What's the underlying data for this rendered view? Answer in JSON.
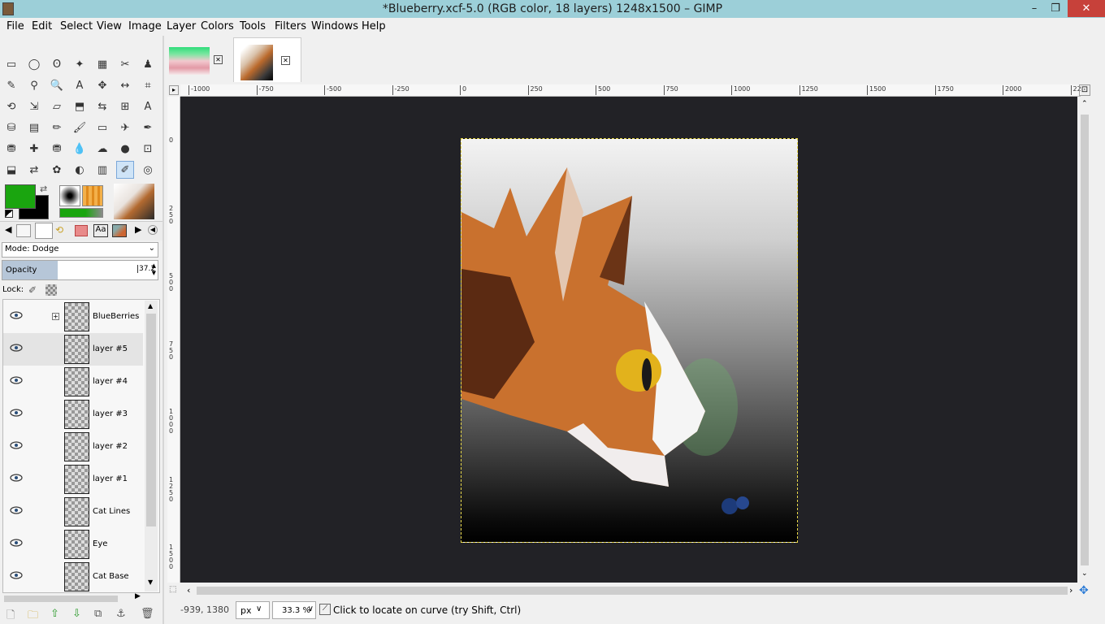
{
  "window": {
    "title": "*Blueberry.xcf-5.0 (RGB color, 18 layers) 1248x1500 – GIMP",
    "minimize": "–",
    "restore": "❐",
    "close": "✕"
  },
  "menu": [
    "File",
    "Edit",
    "Select",
    "View",
    "Image",
    "Layer",
    "Colors",
    "Tools",
    "Filters",
    "Windows",
    "Help"
  ],
  "tools": [
    [
      "rect-select-icon",
      "ellipse-select-icon",
      "free-select-icon",
      "fuzzy-select-icon",
      "color-select-icon",
      "scissors-icon",
      "foreground-select-icon"
    ],
    [
      "paths-icon",
      "color-picker-icon",
      "zoom-icon",
      "measure-icon",
      "move-icon",
      "align-icon",
      "crop-icon"
    ],
    [
      "rotate-icon",
      "scale-icon",
      "shear-icon",
      "perspective-icon",
      "flip-icon",
      "cage-icon",
      "text-icon"
    ],
    [
      "bucket-fill-icon",
      "gradient-icon",
      "pencil-icon",
      "paintbrush-icon",
      "eraser-icon",
      "airbrush-icon",
      "ink-icon"
    ],
    [
      "clone-icon",
      "heal-icon",
      "perspective-clone-icon",
      "blur-icon",
      "smudge-icon",
      "dodge-burn-icon",
      "unified-transform-icon"
    ],
    [
      "warp-icon",
      "handle-transform-icon",
      "mypaint-brush-icon",
      "sharpen-icon",
      "levels-icon",
      "dodge-active-icon",
      "spiral-icon"
    ]
  ],
  "tool_glyphs": [
    [
      "▭",
      "◯",
      "ʘ",
      "✦",
      "▦",
      "✂",
      "♟"
    ],
    [
      "✎",
      "⚲",
      "🔍",
      "A",
      "✥",
      "↔",
      "⌗"
    ],
    [
      "⟲",
      "⇲",
      "▱",
      "⬒",
      "⇆",
      "⊞",
      "A"
    ],
    [
      "⛁",
      "▤",
      "✏",
      "🖌",
      "▭",
      "✈",
      "✒"
    ],
    [
      "⛃",
      "✚",
      "⛃",
      "💧",
      "☁",
      "●",
      "⊡"
    ],
    [
      "⬓",
      "⇄",
      "✿",
      "◐",
      "▥",
      "✐",
      "◎"
    ]
  ],
  "text_tool_label": "A",
  "dock_tabs": [
    "tool-options-tab",
    "layers-tab",
    "paths-tab",
    "undo-tab",
    "brushes-tab",
    "fonts-tab",
    "images-tab"
  ],
  "mode": {
    "label": "Mode: Dodge"
  },
  "opacity": {
    "label": "Opacity",
    "value": "37.2",
    "fraction": 0.372
  },
  "lock": {
    "label": "Lock:"
  },
  "layers": [
    {
      "name": "BlueBerries",
      "group": true,
      "selected": false
    },
    {
      "name": "layer #5",
      "group": false,
      "selected": true
    },
    {
      "name": "layer #4",
      "group": false,
      "selected": false
    },
    {
      "name": "layer #3",
      "group": false,
      "selected": false
    },
    {
      "name": "layer #2",
      "group": false,
      "selected": false
    },
    {
      "name": "layer #1",
      "group": false,
      "selected": false
    },
    {
      "name": "Cat Lines",
      "group": false,
      "selected": false
    },
    {
      "name": "Eye",
      "group": false,
      "selected": false
    },
    {
      "name": "Cat Base",
      "group": false,
      "selected": false
    }
  ],
  "ruler_h": [
    "-1000",
    "-750",
    "-500",
    "-250",
    "0",
    "250",
    "500",
    "750",
    "1000",
    "1250",
    "1500",
    "1750",
    "2000",
    "22"
  ],
  "ruler_v": [
    "0",
    "2 5 0",
    "5 0 0",
    "7 5 0",
    "1 0 0 0",
    "1 2 5 0",
    "1 5 0 0"
  ],
  "status": {
    "coords": "-939, 1380",
    "unit": "px",
    "zoom": "33.3 %",
    "message": "Click to locate on curve (try Shift, Ctrl)"
  },
  "colors": {
    "foreground": "#1aa50f",
    "background": "#000000",
    "canvas": "#222226",
    "titlebar": "#9ccfd8"
  }
}
